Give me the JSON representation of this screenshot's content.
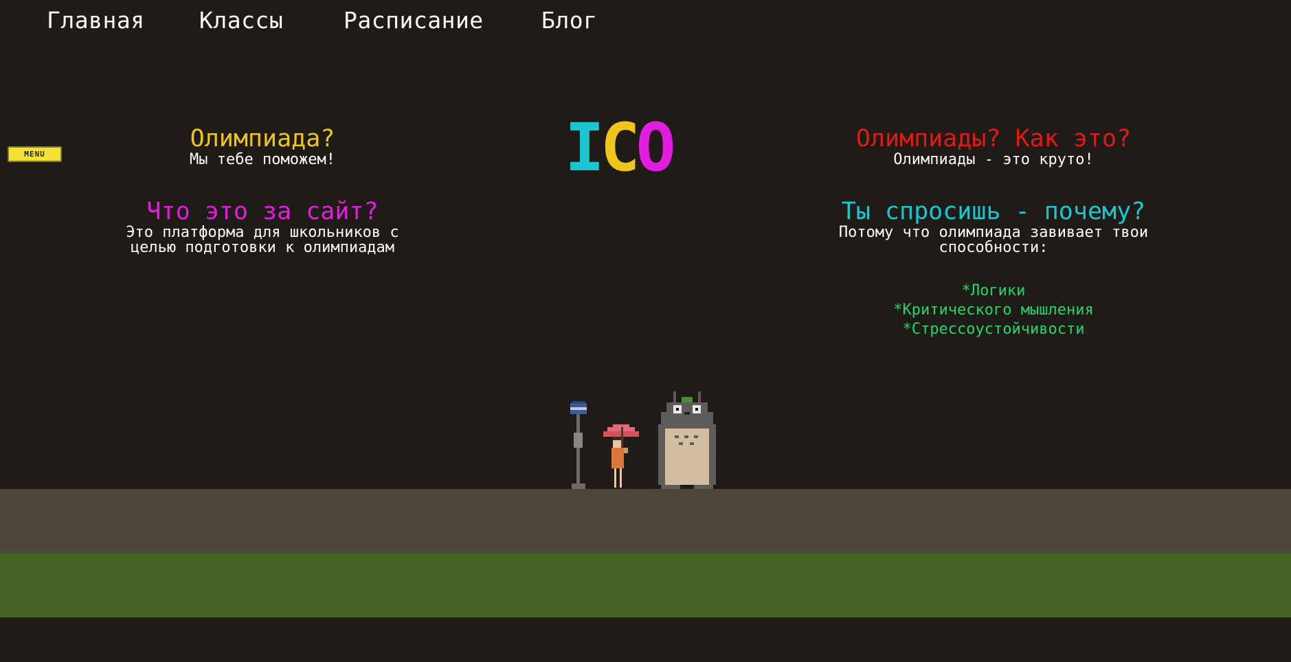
{
  "nav": {
    "items": [
      "Главная",
      "Классы",
      "Расписание",
      "Блог"
    ]
  },
  "menu_button": {
    "label": "MENU"
  },
  "logo": {
    "letters": [
      "I",
      "C",
      "O"
    ],
    "colors": [
      "#1cc6d1",
      "#efc41b",
      "#e21de0"
    ]
  },
  "left_column": {
    "block1": {
      "heading": "Олимпиада?",
      "body": "Мы тебе поможем!"
    },
    "block2": {
      "heading": "Что это за сайт?",
      "body_line1": "Это платформа для школьников с",
      "body_line2": "целью подготовки к олимпиадам"
    }
  },
  "right_column": {
    "block1": {
      "heading": "Олимпиады? Как это?",
      "body": "Олимпиады - это круто!"
    },
    "block2": {
      "heading": "Ты спросишь - почему?",
      "body_line1": "Потому что олимпиада завивает твои",
      "body_line2": "способности:"
    },
    "perks": [
      "*Логики",
      "*Критического мышления",
      "*Стрессоустойчивости"
    ]
  },
  "colors": {
    "background": "#1f1b16",
    "road": "#4f4739",
    "grass": "#466326",
    "yellow": "#efc41b",
    "magenta": "#e21de0",
    "red": "#e01a1a",
    "cyan": "#1cc6d1",
    "green": "#22d66d",
    "menu": "#f3e233"
  },
  "scene": {
    "icons": [
      "bus-stop-sign-icon",
      "girl-with-umbrella-icon",
      "totoro-icon"
    ]
  }
}
